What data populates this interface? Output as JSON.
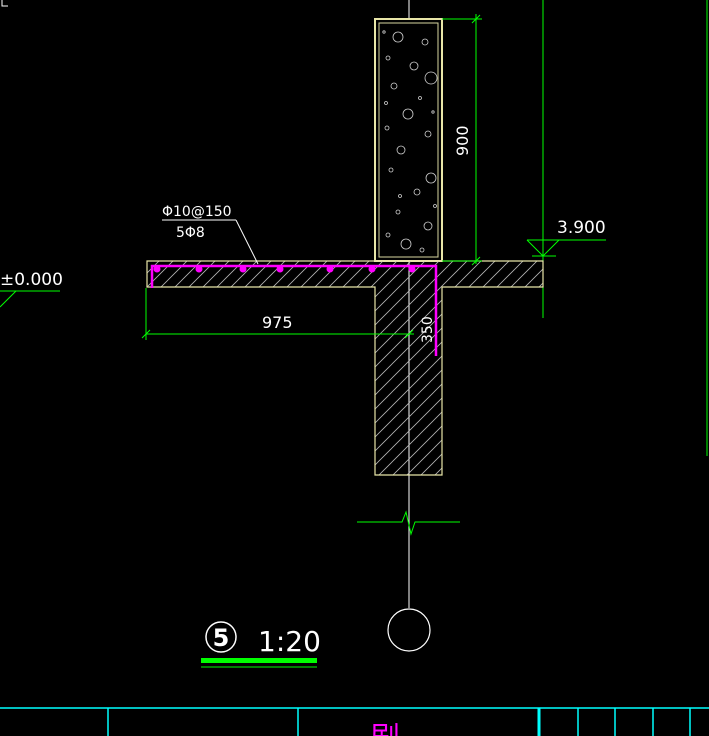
{
  "drawing": {
    "labels": {
      "rebar_top": "Φ10@150",
      "rebar_bottom": "5Φ8",
      "elevation_zero": "±0.000",
      "elevation_slab": "3.900",
      "dim_wall_height": "900",
      "dim_cantilever": "975",
      "dim_beam": "350",
      "detail_number": "5",
      "scale": "1:20",
      "title_block_char": "剧"
    },
    "colors": {
      "background": "#000000",
      "outline": "#ffffff",
      "wall_outline": "#e8e6a8",
      "concrete_hatch": "#bfbfbf",
      "rebar": "#ff00ff",
      "dimension": "#00ff00",
      "title_block": "#00ffff",
      "underline": "#00ff00"
    }
  }
}
